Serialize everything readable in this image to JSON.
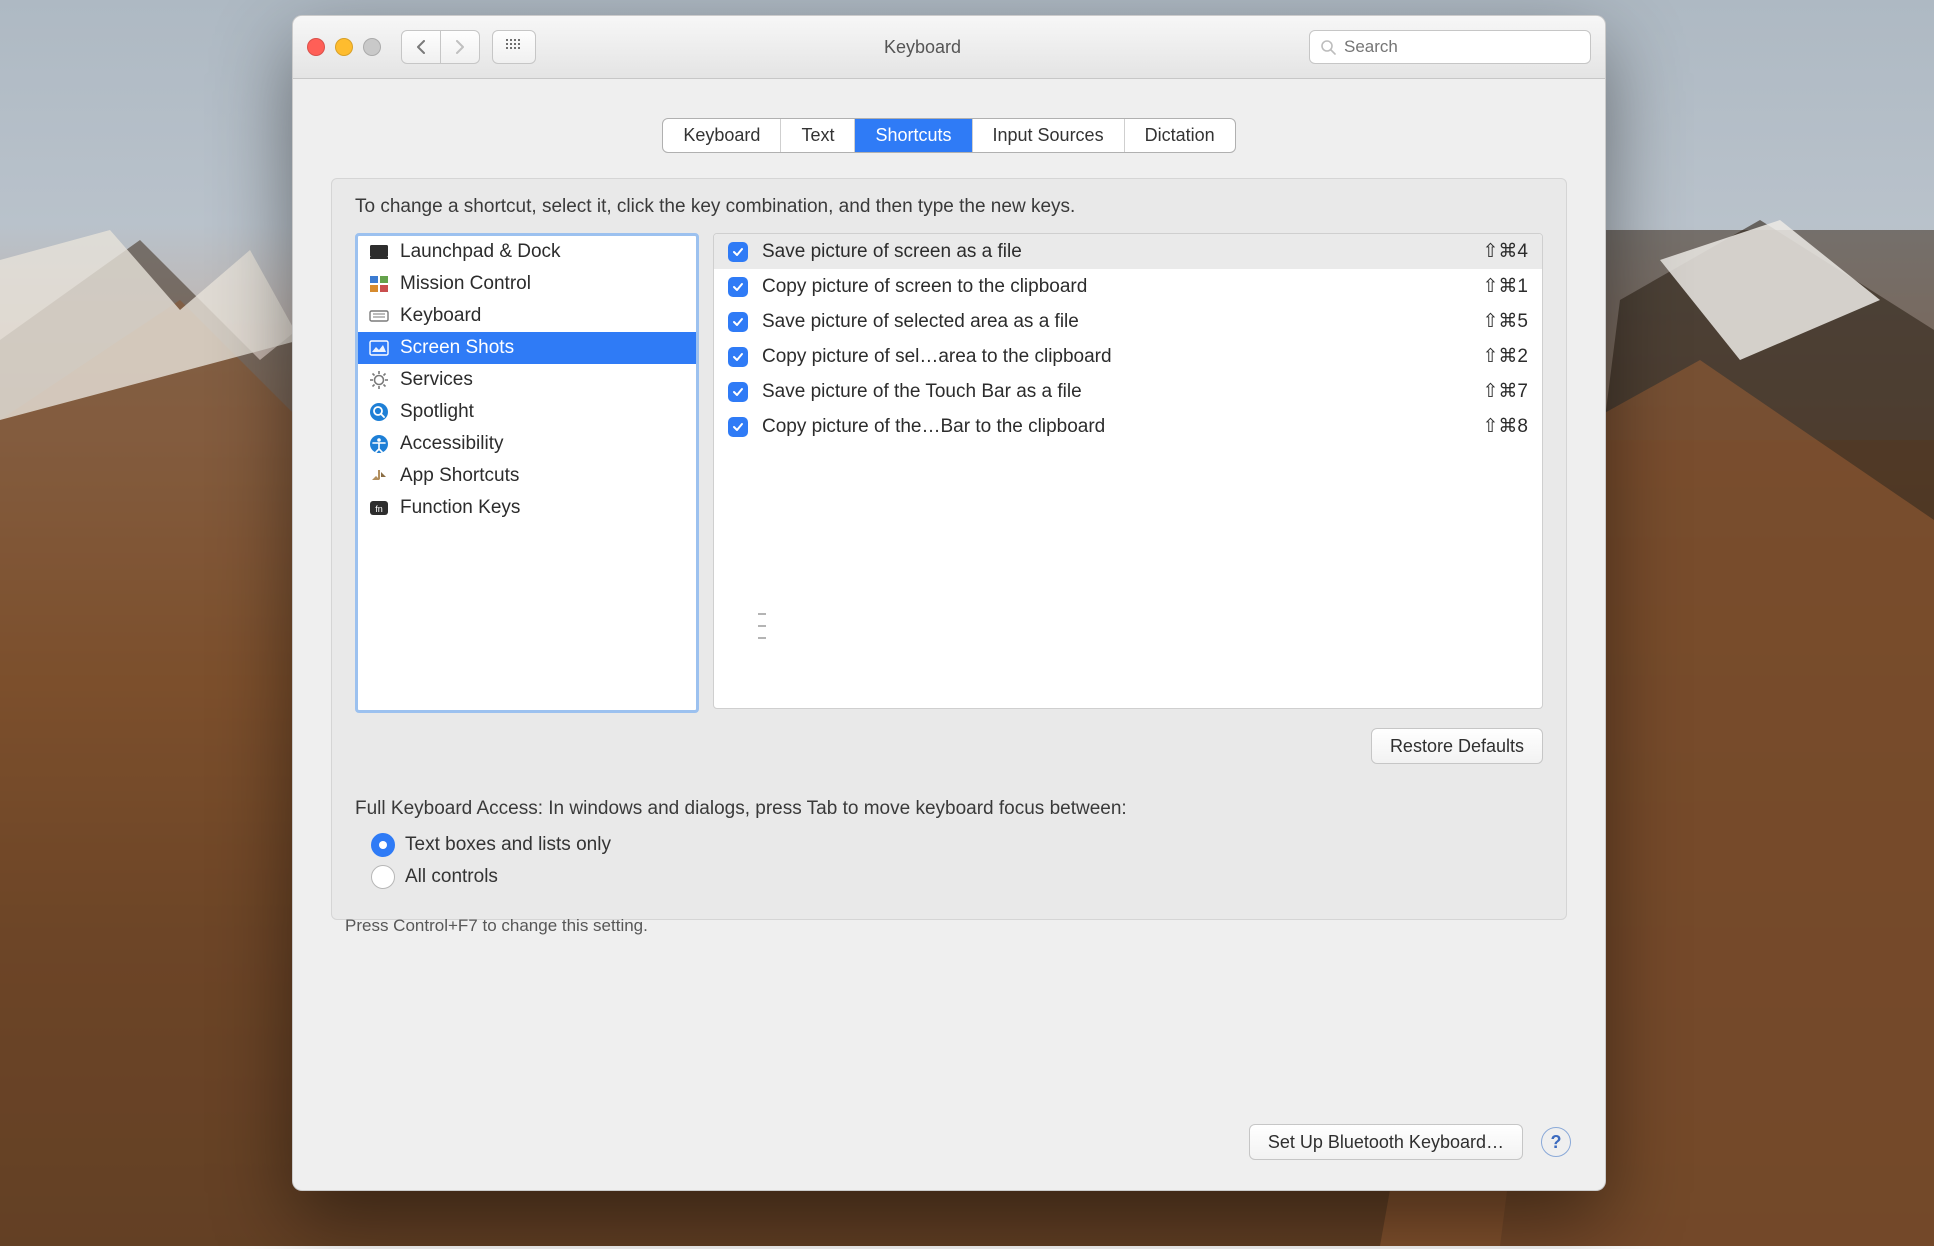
{
  "window": {
    "title": "Keyboard",
    "search_placeholder": "Search"
  },
  "tabs": [
    {
      "label": "Keyboard",
      "active": false
    },
    {
      "label": "Text",
      "active": false
    },
    {
      "label": "Shortcuts",
      "active": true
    },
    {
      "label": "Input Sources",
      "active": false
    },
    {
      "label": "Dictation",
      "active": false
    }
  ],
  "hint": "To change a shortcut, select it, click the key combination, and then type the new keys.",
  "categories": [
    {
      "label": "Launchpad & Dock",
      "icon": "launchpad-icon",
      "selected": false
    },
    {
      "label": "Mission Control",
      "icon": "mission-control-icon",
      "selected": false
    },
    {
      "label": "Keyboard",
      "icon": "keyboard-icon",
      "selected": false
    },
    {
      "label": "Screen Shots",
      "icon": "screenshots-icon",
      "selected": true
    },
    {
      "label": "Services",
      "icon": "services-icon",
      "selected": false
    },
    {
      "label": "Spotlight",
      "icon": "spotlight-icon",
      "selected": false
    },
    {
      "label": "Accessibility",
      "icon": "accessibility-icon",
      "selected": false
    },
    {
      "label": "App Shortcuts",
      "icon": "app-shortcuts-icon",
      "selected": false
    },
    {
      "label": "Function Keys",
      "icon": "function-keys-icon",
      "selected": false
    }
  ],
  "shortcuts": [
    {
      "checked": true,
      "label": "Save picture of screen as a file",
      "keys": "⇧⌘4",
      "selected": true
    },
    {
      "checked": true,
      "label": "Copy picture of screen to the clipboard",
      "keys": "⇧⌘1",
      "selected": false
    },
    {
      "checked": true,
      "label": "Save picture of selected area as a file",
      "keys": "⇧⌘5",
      "selected": false
    },
    {
      "checked": true,
      "label": "Copy picture of sel…area to the clipboard",
      "keys": "⇧⌘2",
      "selected": false
    },
    {
      "checked": true,
      "label": "Save picture of the Touch Bar as a file",
      "keys": "⇧⌘7",
      "selected": false
    },
    {
      "checked": true,
      "label": "Copy picture of the…Bar to the clipboard",
      "keys": "⇧⌘8",
      "selected": false
    }
  ],
  "buttons": {
    "restore": "Restore Defaults",
    "bluetooth": "Set Up Bluetooth Keyboard…"
  },
  "fka": {
    "label": "Full Keyboard Access: In windows and dialogs, press Tab to move keyboard focus between:",
    "options": [
      {
        "label": "Text boxes and lists only",
        "selected": true
      },
      {
        "label": "All controls",
        "selected": false
      }
    ],
    "press_hint": "Press Control+F7 to change this setting."
  }
}
